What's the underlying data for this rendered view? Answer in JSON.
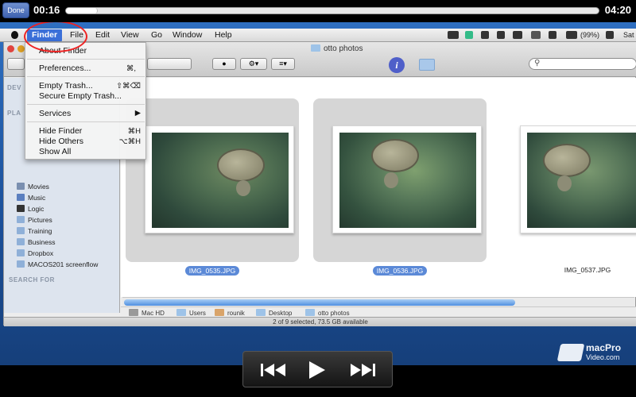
{
  "player": {
    "done_label": "Done",
    "elapsed": "00:16",
    "remaining": "04:20",
    "progress_fraction": 0.06
  },
  "menubar": {
    "items": [
      "Finder",
      "File",
      "Edit",
      "View",
      "Go",
      "Window",
      "Help"
    ],
    "battery": "(99%)",
    "clock": "Sat"
  },
  "finder_menu": {
    "about": "About Finder",
    "preferences": "Preferences...",
    "preferences_shortcut": "⌘,",
    "empty_trash": "Empty Trash...",
    "empty_trash_shortcut": "⇧⌘⌫",
    "secure_empty_trash": "Secure Empty Trash...",
    "services": "Services",
    "hide_finder": "Hide Finder",
    "hide_finder_shortcut": "⌘H",
    "hide_others": "Hide Others",
    "hide_others_shortcut": "⌥⌘H",
    "show_all": "Show All"
  },
  "window": {
    "title": "otto photos"
  },
  "sidebar": {
    "devices_head": "DEV",
    "places_head": "PLA",
    "search_head": "SEARCH FOR",
    "items": [
      "Movies",
      "Music",
      "Logic",
      "Pictures",
      "Training",
      "Business",
      "Dropbox",
      "MACOS201 screenflow"
    ]
  },
  "files": [
    {
      "name": "IMG_0535.JPG"
    },
    {
      "name": "IMG_0536.JPG"
    },
    {
      "name": "IMG_0537.JPG"
    }
  ],
  "path": [
    "Mac HD",
    "Users",
    "rounik",
    "Desktop",
    "otto photos"
  ],
  "status": "2 of 9 selected, 73.5 GB available",
  "watermark": {
    "line1": "macPro",
    "line2": "Video.com"
  },
  "colors": {
    "selection": "#3a6fd8",
    "annotation_ring": "#ee2222"
  }
}
